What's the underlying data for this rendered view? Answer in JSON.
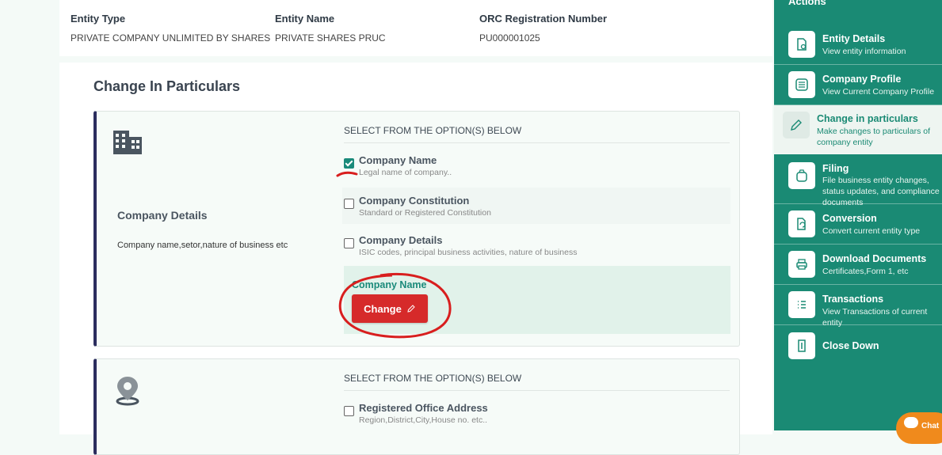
{
  "entity": {
    "type_label": "Entity Type",
    "type_value": "PRIVATE COMPANY UNLIMITED BY SHARES",
    "name_label": "Entity Name",
    "name_value": "PRIVATE SHARES PRUC",
    "reg_label": "ORC Registration Number",
    "reg_value": "PU000001025"
  },
  "page_title": "Change In Particulars",
  "section1": {
    "title": "Company Details",
    "description": "Company name,setor,nature of business etc",
    "options_header": "SELECT FROM THE OPTION(S) BELOW",
    "options": [
      {
        "title": "Company Name",
        "subtitle": "Legal name of company..",
        "checked": true
      },
      {
        "title": "Company Constitution",
        "subtitle": "Standard or Registered Constitution",
        "checked": false
      },
      {
        "title": "Company Details",
        "subtitle": "ISIC codes, principal business activities, nature of business",
        "checked": false
      }
    ],
    "change_panel_label": "Company Name",
    "change_button": "Change"
  },
  "section2": {
    "options_header": "SELECT FROM THE OPTION(S) BELOW",
    "options": [
      {
        "title": "Registered Office Address",
        "subtitle": "Region,District,City,House no. etc..",
        "checked": false
      }
    ]
  },
  "sidebar": {
    "title": "Actions",
    "items": [
      {
        "label": "Entity Details",
        "sub": "View entity information",
        "icon": "document-search-icon"
      },
      {
        "label": "Company Profile",
        "sub": "View Current Company Profile",
        "icon": "profile-list-icon"
      },
      {
        "label": "Change in particulars",
        "sub": "Make changes to particulars of company entity",
        "icon": "pencil-icon"
      },
      {
        "label": "Filing",
        "sub": "File business entity changes, status updates, and compliance documents",
        "icon": "money-bag-icon"
      },
      {
        "label": "Conversion",
        "sub": "Convert current entity type",
        "icon": "convert-icon"
      },
      {
        "label": "Download Documents",
        "sub": "Certificates,Form 1, etc",
        "icon": "printer-icon"
      },
      {
        "label": "Transactions",
        "sub": "View Transactions of current entity",
        "icon": "list-icon"
      },
      {
        "label": "Close Down",
        "sub": "",
        "icon": "close-down-icon"
      }
    ]
  },
  "chat_label": "Chat",
  "colors": {
    "accent": "#1a8a74",
    "button_red": "#d62a2a",
    "section_border": "#2b2d5e"
  }
}
